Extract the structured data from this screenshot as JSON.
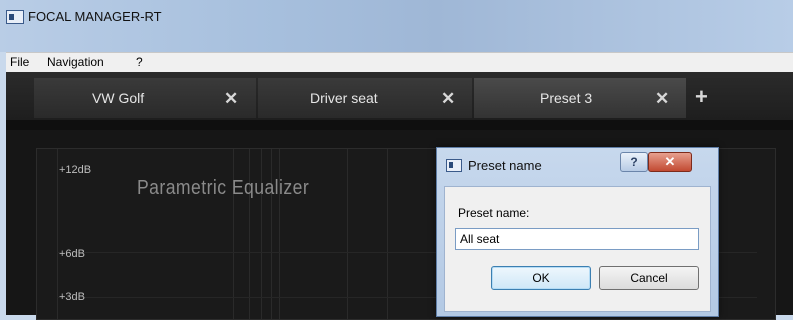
{
  "window": {
    "title": "FOCAL MANAGER-RT"
  },
  "menu": {
    "items": [
      "File",
      "Navigation",
      "?"
    ]
  },
  "tabs": [
    {
      "label": "VW Golf",
      "close": "✕"
    },
    {
      "label": "Driver seat",
      "close": "✕"
    },
    {
      "label": "Preset 3",
      "close": "✕"
    }
  ],
  "add_tab": "+",
  "graph": {
    "title": "Parametric Equalizer",
    "y_labels": [
      "+12dB",
      "+6dB",
      "+3dB"
    ]
  },
  "dialog": {
    "title": "Preset name",
    "help": "?",
    "close": "✕",
    "field_label": "Preset name:",
    "field_value": "All seat",
    "ok": "OK",
    "cancel": "Cancel"
  }
}
